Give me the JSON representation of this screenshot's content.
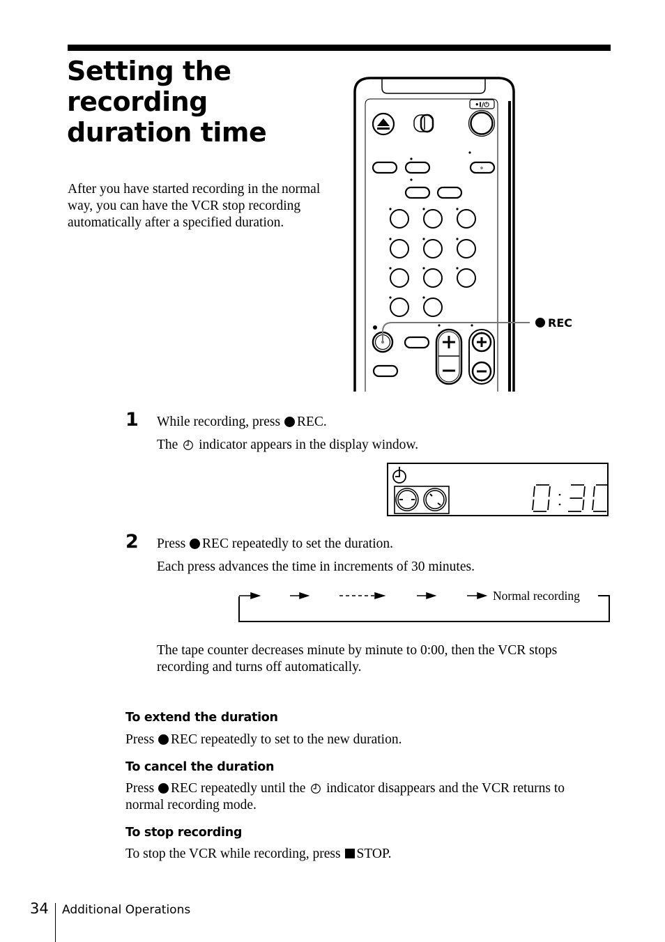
{
  "page": {
    "title_lines": [
      "Setting the",
      "recording",
      "duration time"
    ],
    "intro": "After you have started recording in the normal way, you can have the VCR stop recording automatically after a specified duration."
  },
  "remote": {
    "callout_label": "REC",
    "power_label": "•I/⏻",
    "icons": {
      "eject": "eject-icon",
      "switch": "slide-switch-icon",
      "power": "power-button-icon",
      "rec": "record-button-icon"
    }
  },
  "steps": [
    {
      "number": "1",
      "line1_before": "While recording, press",
      "line1_after": "REC.",
      "line2_before": "The",
      "line2_after": "indicator appears in the display window."
    },
    {
      "number": "2",
      "line1_before": "Press",
      "line1_after": "REC repeatedly to set the duration.",
      "line2": "Each press advances the time in increments of 30 minutes."
    }
  ],
  "display_window": {
    "timer_icon": "timer-icon",
    "time_readout": "0:30",
    "cassette_icon": "cassette-icon"
  },
  "sequence": {
    "end_label": "Normal recording"
  },
  "after_text": "The tape counter decreases minute by minute to 0:00, then the VCR stops recording and turns off automatically.",
  "sections": [
    {
      "heading": "To extend the duration",
      "text_before": "Press",
      "text_after": "REC repeatedly to set to the new duration."
    },
    {
      "heading": "To cancel the duration",
      "text_before": "Press",
      "text_mid": "REC repeatedly until the",
      "text_after": "indicator disappears and the VCR returns to normal recording mode."
    },
    {
      "heading": "To stop recording",
      "text_before": "To stop the VCR while recording, press",
      "text_after": "STOP."
    }
  ],
  "footer": {
    "page_number": "34",
    "section": "Additional Operations"
  }
}
